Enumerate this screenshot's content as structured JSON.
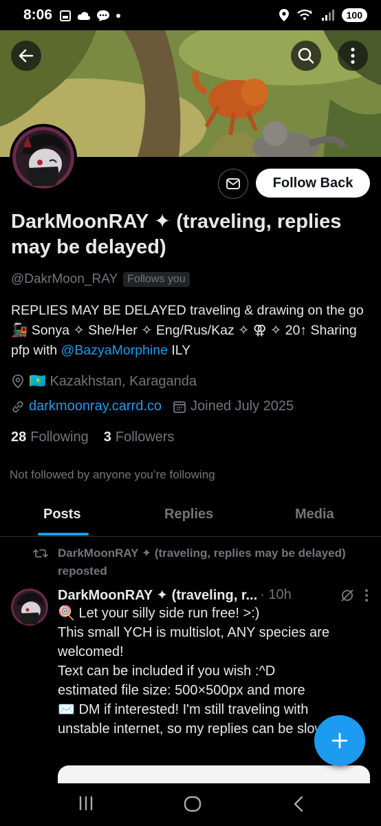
{
  "status_bar": {
    "time": "8:06",
    "battery": "100",
    "signal_label": "6"
  },
  "header": {
    "back_icon": "arrow-left-icon",
    "search_icon": "search-icon",
    "more_icon": "more-vertical-icon"
  },
  "profile": {
    "display_name": "DarkMoonRAY ✦ (traveling, replies may be delayed)",
    "handle": "@DakrMoon_RAY",
    "follows_you_badge": "Follows you",
    "follow_button": "Follow Back",
    "bio_line1": "REPLIES MAY BE DELAYED traveling & drawing on the go 🚂 Sonya ✧ She/Her ✧ Eng/Rus/Kaz ✧ ⚢ ✧ 20↑ Sharing pfp with ",
    "bio_mention": "@BazyaMorphine",
    "bio_end": " ILY",
    "location": "🇰🇿 Kazakhstan, Karaganda",
    "website": "darkmoonray.carrd.co",
    "joined": "Joined July 2025",
    "following_count": "28",
    "following_label": "Following",
    "followers_count": "3",
    "followers_label": "Followers",
    "not_followed": "Not followed by anyone you’re following"
  },
  "tabs": [
    "Posts",
    "Replies",
    "Media"
  ],
  "post": {
    "repost_label": "DarkMoonRAY ✦ (traveling, replies may be delayed) reposted",
    "author": "DarkMoonRAY ✦ (traveling, r...",
    "time": "· 10h",
    "lines": [
      "🍭 Let your silly side run free! >:)",
      "This small YCH is multislot, ANY species are welcomed!",
      "Text can be included if you wish :^D",
      "estimated file size: 500×500px and more",
      "✉️ DM if interested! I'm still traveling with unstable internet, so my replies can be slow <\"3"
    ]
  },
  "colors": {
    "accent": "#1d9bf0",
    "background": "#000000",
    "muted": "#71767b",
    "text": "#e7e9ea"
  }
}
